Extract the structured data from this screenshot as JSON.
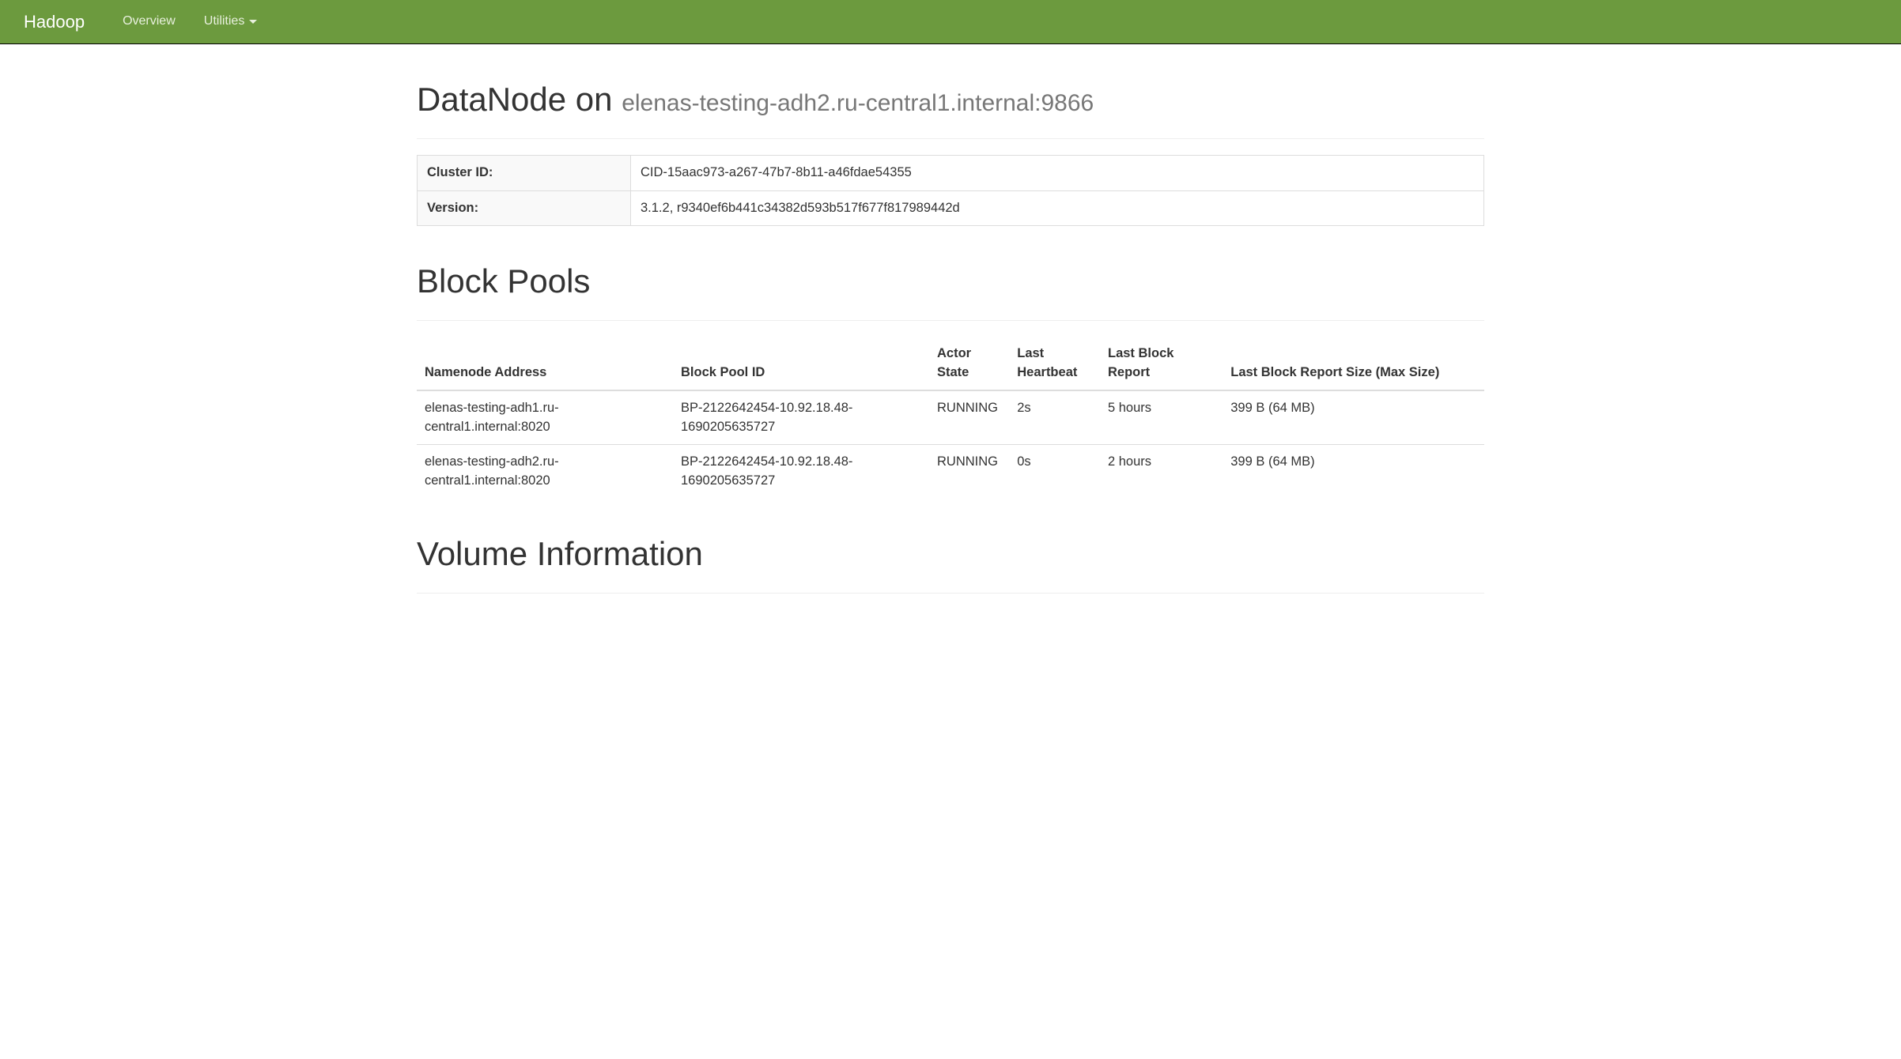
{
  "navbar": {
    "brand": "Hadoop",
    "overview": "Overview",
    "utilities": "Utilities"
  },
  "header": {
    "title": "DataNode on",
    "host": "elenas-testing-adh2.ru-central1.internal:9866"
  },
  "info": {
    "cluster_id_label": "Cluster ID:",
    "cluster_id_value": "CID-15aac973-a267-47b7-8b11-a46fdae54355",
    "version_label": "Version:",
    "version_value": "3.1.2, r9340ef6b441c34382d593b517f677f817989442d"
  },
  "block_pools": {
    "title": "Block Pools",
    "columns": {
      "namenode": "Namenode Address",
      "pool_id": "Block Pool ID",
      "actor_state": "Actor State",
      "last_heartbeat": "Last Heartbeat",
      "last_block_report": "Last Block Report",
      "last_block_report_size": "Last Block Report Size (Max Size)"
    },
    "rows": [
      {
        "namenode": "elenas-testing-adh1.ru-central1.internal:8020",
        "pool_id": "BP-2122642454-10.92.18.48-1690205635727",
        "actor_state": "RUNNING",
        "last_heartbeat": "2s",
        "last_block_report": "5 hours",
        "last_block_report_size": "399 B (64 MB)"
      },
      {
        "namenode": "elenas-testing-adh2.ru-central1.internal:8020",
        "pool_id": "BP-2122642454-10.92.18.48-1690205635727",
        "actor_state": "RUNNING",
        "last_heartbeat": "0s",
        "last_block_report": "2 hours",
        "last_block_report_size": "399 B (64 MB)"
      }
    ]
  },
  "volume_info": {
    "title": "Volume Information"
  }
}
